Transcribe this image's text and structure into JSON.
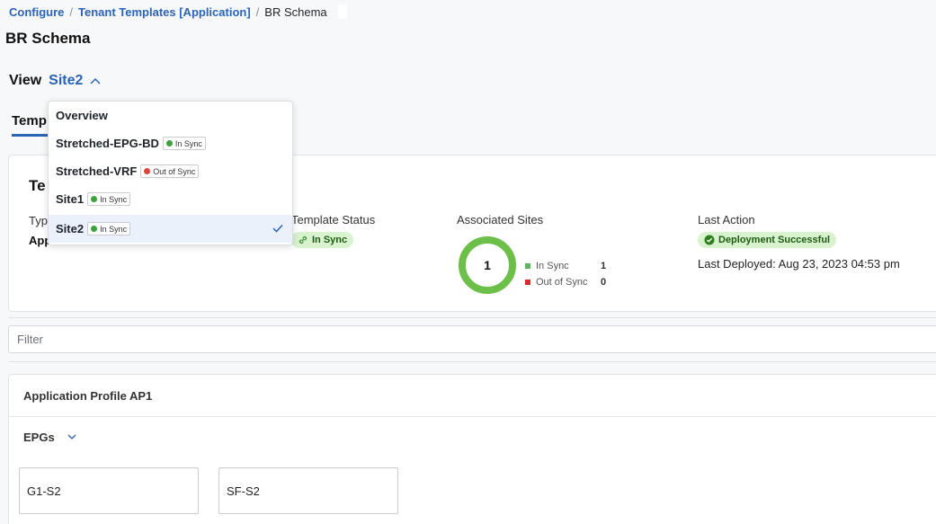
{
  "breadcrumb": {
    "items": [
      "Configure",
      "Tenant Templates [Application]"
    ],
    "current": "BR Schema"
  },
  "page": {
    "title": "BR Schema"
  },
  "view": {
    "label": "View",
    "selected": "Site2"
  },
  "tabs": {
    "active_label": "Temp"
  },
  "dropdown": {
    "items": [
      {
        "name": "Overview"
      },
      {
        "name": "Stretched-EPG-BD",
        "status": "In Sync"
      },
      {
        "name": "Stretched-VRF",
        "status": "Out of Sync"
      },
      {
        "name": "Site1",
        "status": "In Sync"
      },
      {
        "name": "Site2",
        "status": "In Sync"
      }
    ]
  },
  "summary": {
    "title": "Te",
    "type_label": "Typ",
    "type_value": "App",
    "template_status_label": "Template Status",
    "template_status_value": "In Sync",
    "associated_sites_label": "Associated Sites",
    "associated_sites_count": "1",
    "legend": [
      {
        "name": "In Sync",
        "count": "1",
        "color": "#5cb85c"
      },
      {
        "name": "Out of Sync",
        "count": "0",
        "color": "#d9292b"
      }
    ],
    "last_action_label": "Last Action",
    "last_action_value": "Deployment Successful",
    "last_deployed": "Last Deployed: Aug 23, 2023 04:53 pm"
  },
  "filter": {
    "placeholder": "Filter"
  },
  "app_profile": {
    "title": "Application Profile AP1",
    "epgs_label": "EPGs",
    "epgs": [
      "G1-S2",
      "SF-S2"
    ]
  },
  "colors": {
    "accent": "#2b63b5",
    "success": "#3aa33a",
    "danger": "#d9463b",
    "donut": "#6cc04a"
  }
}
